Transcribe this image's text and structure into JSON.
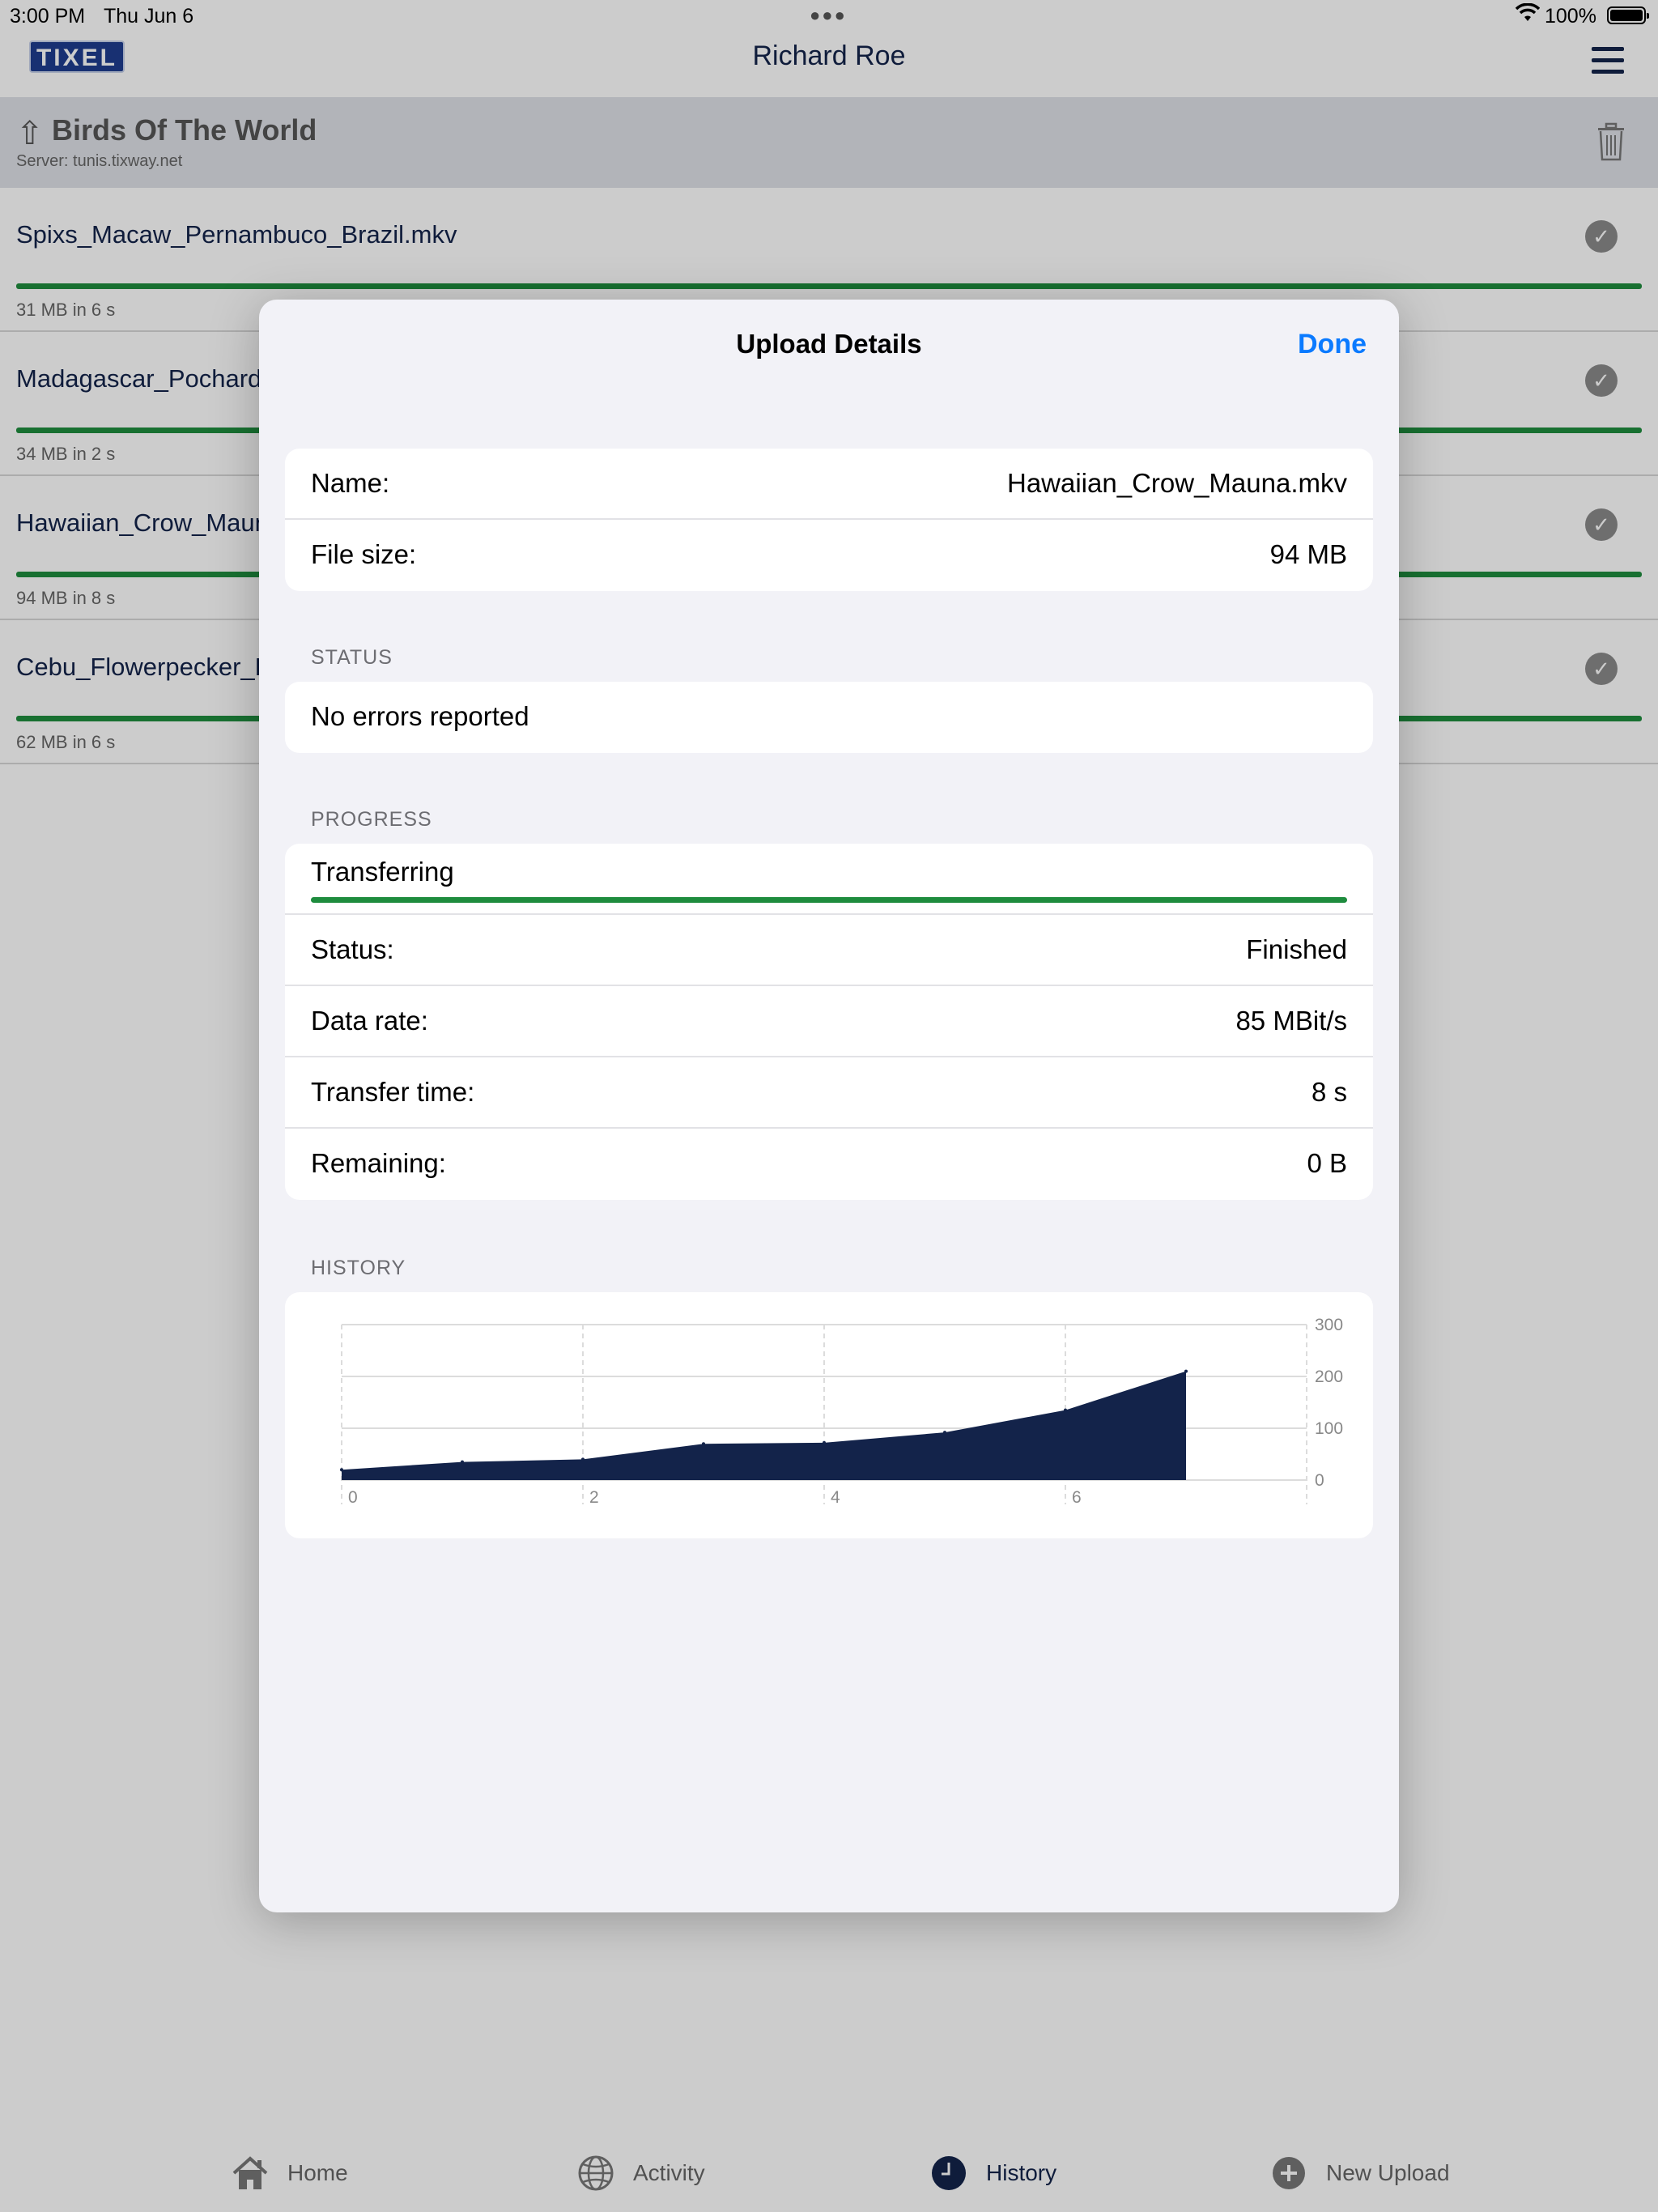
{
  "status_bar": {
    "time": "3:00 PM",
    "date": "Thu Jun 6",
    "battery": "100%"
  },
  "navbar": {
    "logo": "TIXEL",
    "title": "Richard Roe"
  },
  "folder": {
    "name": "Birds Of The World",
    "server": "Server: tunis.tixway.net"
  },
  "files": [
    {
      "name": "Spixs_Macaw_Pernambuco_Brazil.mkv",
      "meta": "31 MB in 6 s",
      "progress": 1.0
    },
    {
      "name": "Madagascar_Pochard_W",
      "meta": "34 MB in 2 s",
      "progress": 1.0
    },
    {
      "name": "Hawaiian_Crow_Mauna.",
      "meta": "94 MB in 8 s",
      "progress": 1.0
    },
    {
      "name": "Cebu_Flowerpecker_Phi",
      "meta": "62 MB in 6 s",
      "progress": 1.0
    }
  ],
  "tabs": [
    {
      "label": "Home",
      "icon": "home-icon"
    },
    {
      "label": "Activity",
      "icon": "globe-icon"
    },
    {
      "label": "History",
      "icon": "clock-icon",
      "active": true
    },
    {
      "label": "New Upload",
      "icon": "plus-circle-icon"
    }
  ],
  "sheet": {
    "title": "Upload Details",
    "done_label": "Done",
    "details": {
      "name_label": "Name:",
      "name_value": "Hawaiian_Crow_Mauna.mkv",
      "size_label": "File size:",
      "size_value": "94 MB"
    },
    "status": {
      "section": "STATUS",
      "message": "No errors reported"
    },
    "progress": {
      "section": "PROGRESS",
      "phase": "Transferring",
      "fraction": 1.0,
      "status_label": "Status:",
      "status_value": "Finished",
      "rate_label": "Data rate:",
      "rate_value": "85 MBit/s",
      "time_label": "Transfer time:",
      "time_value": "8 s",
      "remaining_label": "Remaining:",
      "remaining_value": "0 B"
    },
    "history_section": "HISTORY"
  },
  "colors": {
    "accent": "#0a7aff",
    "progress": "#1e8c3e",
    "chart_fill": "#13234a",
    "brand": "#1e3d8f"
  },
  "chart_data": {
    "type": "area",
    "x": [
      0,
      1,
      2,
      3,
      4,
      5,
      6,
      7
    ],
    "values": [
      20,
      35,
      40,
      70,
      72,
      92,
      135,
      210
    ],
    "xticks": [
      0,
      2,
      4,
      6
    ],
    "yticks": [
      0,
      100,
      200,
      300
    ],
    "xlim": [
      0,
      8
    ],
    "ylim": [
      0,
      300
    ],
    "y_axis_side": "right",
    "grid": true,
    "title": "",
    "xlabel": "",
    "ylabel": ""
  }
}
